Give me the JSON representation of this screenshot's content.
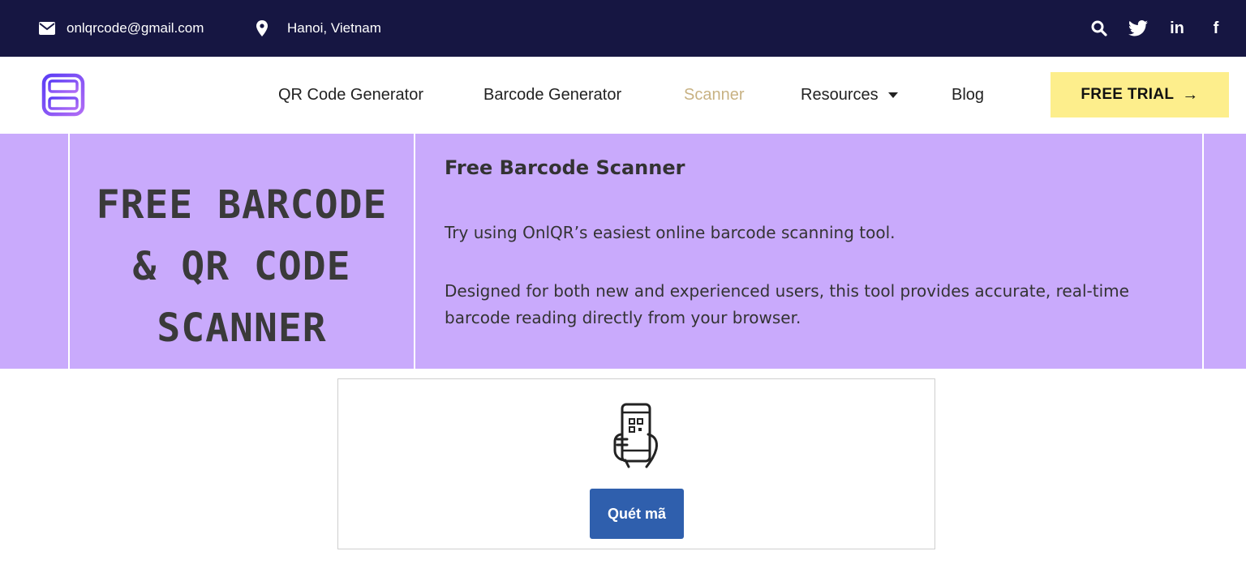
{
  "topbar": {
    "email": "onlqrcode@gmail.com",
    "location": "Hanoi, Vietnam",
    "social": [
      "search-icon",
      "twitter-icon",
      "linkedin-icon",
      "facebook-icon"
    ],
    "linkedin_text": "in",
    "facebook_text": "f"
  },
  "nav": {
    "items": [
      {
        "label": "QR Code Generator"
      },
      {
        "label": "Barcode Generator"
      },
      {
        "label": "Scanner",
        "active": true
      },
      {
        "label": "Resources"
      },
      {
        "label": "Blog"
      }
    ],
    "trial_label": "FREE TRIAL",
    "trial_arrow": "→"
  },
  "hero": {
    "title_lines": [
      "FREE BARCODE",
      "& QR CODE",
      "SCANNER"
    ],
    "subtitle": "Free Barcode Scanner",
    "p1": "Try using OnlQR’s easiest online barcode scanning tool.",
    "p2": "Designed for both new and experienced users, this tool provides accurate, real-time barcode reading directly from your browser."
  },
  "scanner": {
    "icon": "phone-scan-icon",
    "button_label": "Quét mã"
  },
  "colors": {
    "topbar_bg": "#161642",
    "hero_bg": "#c9aafc",
    "trial_bg": "#fdee8c",
    "scan_button_bg": "#2f5fad",
    "active_nav": "#c8b283"
  }
}
